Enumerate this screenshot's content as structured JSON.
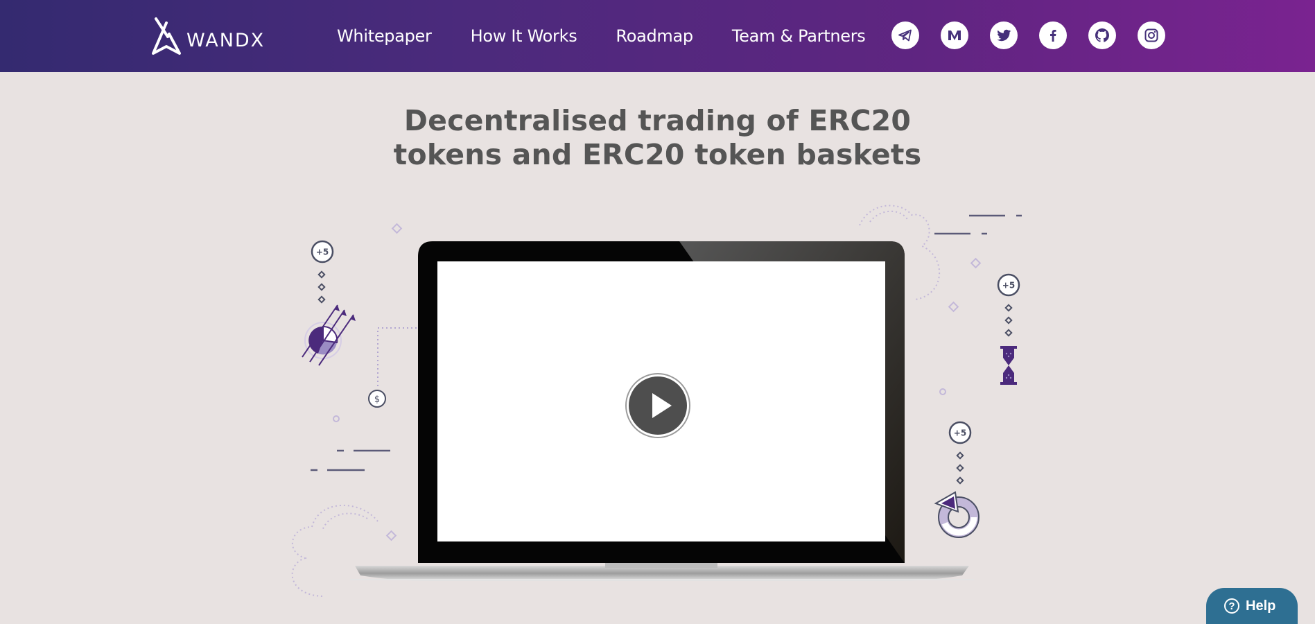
{
  "brand": {
    "name": "WANDX"
  },
  "nav": {
    "items": [
      {
        "label": "Whitepaper"
      },
      {
        "label": "How It Works"
      },
      {
        "label": "Roadmap"
      },
      {
        "label": "Team & Partners"
      }
    ]
  },
  "social": {
    "icons": [
      "telegram-icon",
      "medium-icon",
      "twitter-icon",
      "facebook-icon",
      "github-icon",
      "instagram-icon"
    ]
  },
  "hero": {
    "headline_line1": "Decentralised trading of ERC20",
    "headline_line2": "tokens and ERC20 token baskets"
  },
  "illustration": {
    "badge_left": "+5",
    "badge_right_top": "+5",
    "badge_right_bottom": "+5",
    "coin": "$"
  },
  "help": {
    "label": "Help",
    "icon_glyph": "?"
  },
  "colors": {
    "header_gradient_start": "#342a70",
    "header_gradient_end": "#7a2390",
    "page_background": "#e8e2e1",
    "headline_text": "#555555",
    "accent_purple": "#4b2a7c",
    "help_button": "#2e6f92"
  }
}
